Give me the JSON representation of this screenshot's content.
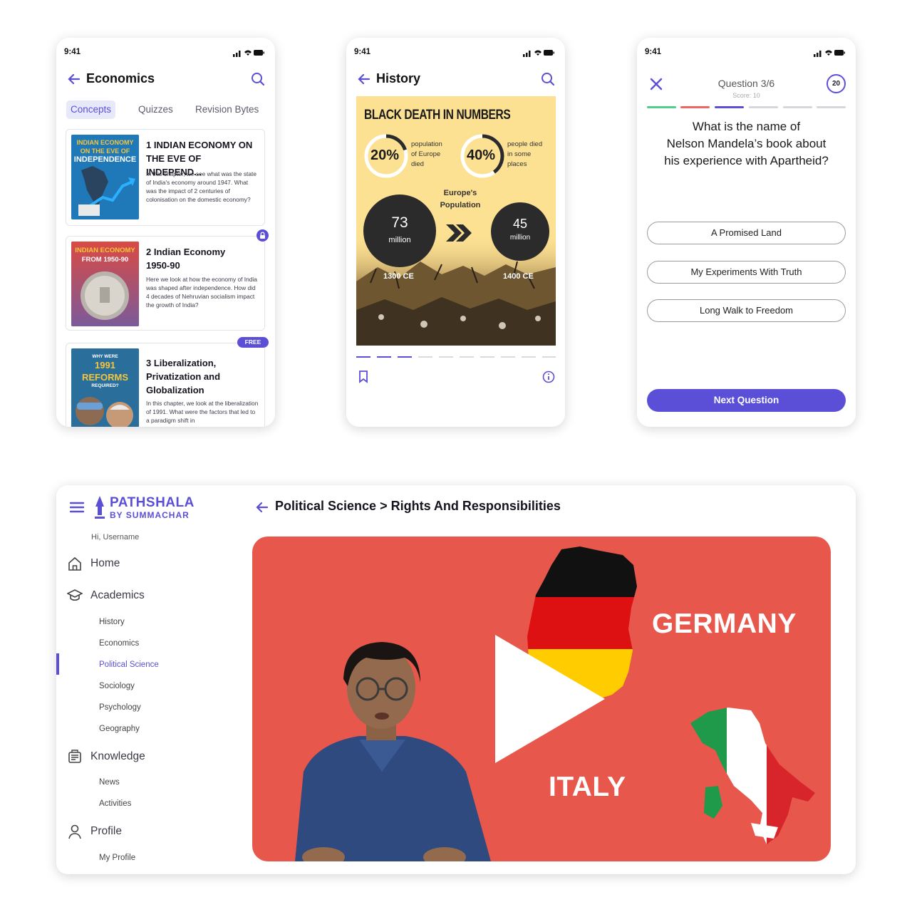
{
  "status": {
    "time": "9:41"
  },
  "economics": {
    "title": "Economics",
    "tabs": [
      "Concepts",
      "Quizzes",
      "Revision Bytes"
    ],
    "cards": [
      {
        "thumb": [
          "INDIAN ECONOMY",
          "ON THE EVE OF",
          "INDEPENDENCE"
        ],
        "title": "1 INDIAN ECONOMY ON THE EVE OF INDEPEND...",
        "desc": "In this chapter, we see what was the state of India's economy around 1947. What was the impact of 2 centuries of colonisation on the domestic economy?"
      },
      {
        "thumb": [
          "INDIAN ECONOMY",
          "FROM 1950-90"
        ],
        "title": "2 Indian Economy 1950-90",
        "desc": "Here we look at how the economy of India was shaped after independence. How did 4 decades of Nehruvian socialism impact the growth of India?"
      },
      {
        "thumb": [
          "WHY WERE",
          "1991 REFORMS",
          "REQUIRED?"
        ],
        "badge": "FREE",
        "title": "3 Liberalization, Privatization and Globalization",
        "desc": "In this chapter, we look at the liberalization of 1991. What were the factors that led to a paradigm shift in"
      }
    ]
  },
  "history": {
    "title": "History",
    "infographic": {
      "title": "BLACK DEATH IN NUMBERS",
      "stat1": {
        "value": "20%",
        "fill": 0.2,
        "text": [
          "population",
          "of Europe",
          "died"
        ]
      },
      "stat2": {
        "value": "40%",
        "fill": 0.4,
        "text": [
          "people died",
          "in some",
          "places"
        ]
      },
      "pop_label": [
        "Europe's",
        "Population"
      ],
      "pop1": {
        "n": "73",
        "unit": "million",
        "era": "1300 CE"
      },
      "pop2": {
        "n": "45",
        "unit": "million",
        "era": "1400 CE"
      }
    }
  },
  "quiz": {
    "question_no": "Question 3/6",
    "score": "Score: 10",
    "timer": "20",
    "progress_colors": [
      "#4dd08a",
      "#f06464",
      "#5a4fd6",
      "#d6d6dc",
      "#d6d6dc",
      "#d6d6dc"
    ],
    "question": [
      "What is the name of",
      "Nelson Mandela’s book about",
      "his experience with Apartheid?"
    ],
    "options": [
      "A Promised Land",
      "My Experiments With Truth",
      "Long Walk to Freedom"
    ],
    "next": "Next Question"
  },
  "desktop": {
    "brand": [
      "PATHSHALA",
      "BY SUMMACHAR"
    ],
    "greeting": "Hi, Username",
    "nav": {
      "home": "Home",
      "academics": "Academics",
      "academics_items": [
        "History",
        "Economics",
        "Political Science",
        "Sociology",
        "Psychology",
        "Geography"
      ],
      "knowledge": "Knowledge",
      "knowledge_items": [
        "News",
        "Activities"
      ],
      "profile": "Profile",
      "profile_items": [
        "My Profile"
      ]
    },
    "breadcrumb": "Political Science > Rights And Responsibilities",
    "video": {
      "label1": "GERMANY",
      "label2": "ITALY"
    }
  },
  "colors": {
    "accent": "#5a4fd6",
    "video_bg": "#e7574b",
    "infographic_bg": "#fde193"
  }
}
